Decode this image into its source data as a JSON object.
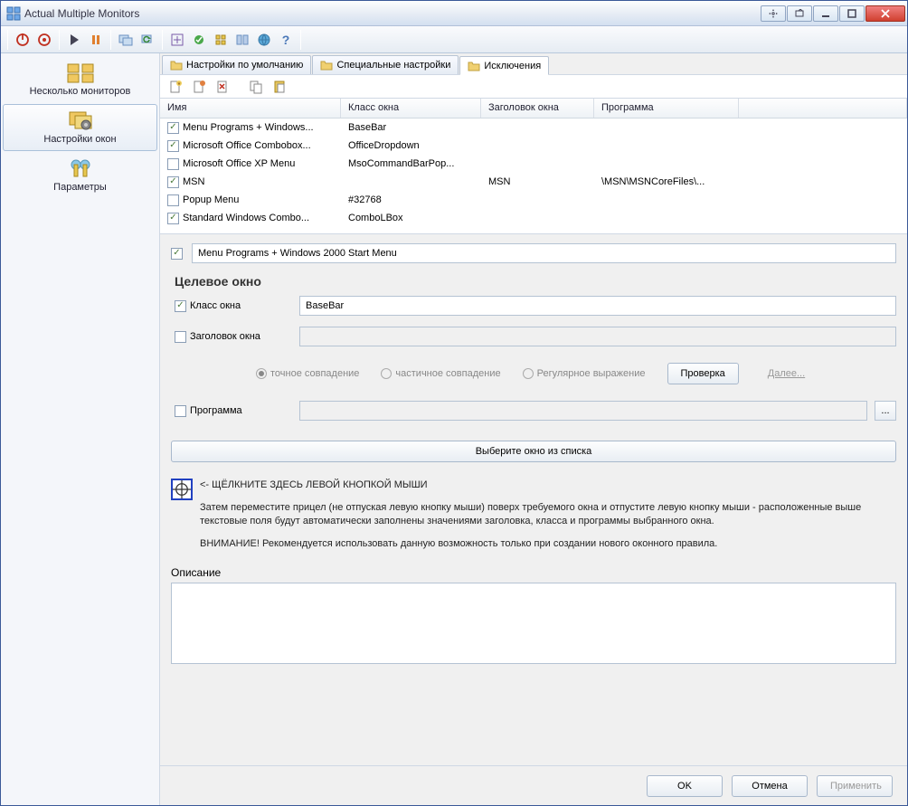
{
  "window": {
    "title": "Actual Multiple Monitors"
  },
  "sidebar": {
    "items": [
      {
        "label": "Несколько мониторов"
      },
      {
        "label": "Настройки окон"
      },
      {
        "label": "Параметры"
      }
    ]
  },
  "tabs": {
    "defaults": "Настройки по умолчанию",
    "special": "Специальные настройки",
    "exclusions": "Исключения"
  },
  "grid": {
    "headers": {
      "name": "Имя",
      "class": "Класс окна",
      "title": "Заголовок окна",
      "program": "Программа"
    },
    "rows": [
      {
        "checked": true,
        "name": "Menu Programs + Windows...",
        "class": "BaseBar",
        "title": "",
        "program": ""
      },
      {
        "checked": true,
        "name": "Microsoft Office Combobox...",
        "class": "OfficeDropdown",
        "title": "",
        "program": ""
      },
      {
        "checked": false,
        "name": "Microsoft Office XP Menu",
        "class": "MsoCommandBarPop...",
        "title": "",
        "program": ""
      },
      {
        "checked": true,
        "name": "MSN",
        "class": "",
        "title": "MSN",
        "program": "\\MSN\\MSNCoreFiles\\..."
      },
      {
        "checked": false,
        "name": "Popup Menu",
        "class": "#32768",
        "title": "",
        "program": ""
      },
      {
        "checked": true,
        "name": "Standard Windows Combo...",
        "class": "ComboLBox",
        "title": "",
        "program": ""
      }
    ]
  },
  "detail": {
    "enabled": true,
    "name_value": "Menu Programs + Windows 2000 Start Menu",
    "group_title": "Целевое окно",
    "class_label": "Класс окна",
    "class_checked": true,
    "class_value": "BaseBar",
    "title_label": "Заголовок окна",
    "title_checked": false,
    "title_value": "",
    "match_exact": "точное совпадение",
    "match_partial": "частичное совпадение",
    "match_regex": "Регулярное выражение",
    "check_btn": "Проверка",
    "next_link": "Далее...",
    "program_label": "Программа",
    "program_checked": false,
    "program_value": "",
    "pick_btn": "Выберите окно из списка",
    "click_hint": "<- ЩЁЛКНИТЕ ЗДЕСЬ ЛЕВОЙ КНОПКОЙ МЫШИ",
    "instr1": "Затем переместите прицел (не отпуская левую кнопку мыши) поверх требуемого окна и отпустите левую кнопку мыши - расположенные выше текстовые поля будут автоматически заполнены значениями заголовка, класса и программы выбранного окна.",
    "instr2": "ВНИМАНИЕ! Рекомендуется использовать данную возможность только при создании нового оконного правила.",
    "desc_label": "Описание"
  },
  "footer": {
    "ok": "OK",
    "cancel": "Отмена",
    "apply": "Применить"
  }
}
